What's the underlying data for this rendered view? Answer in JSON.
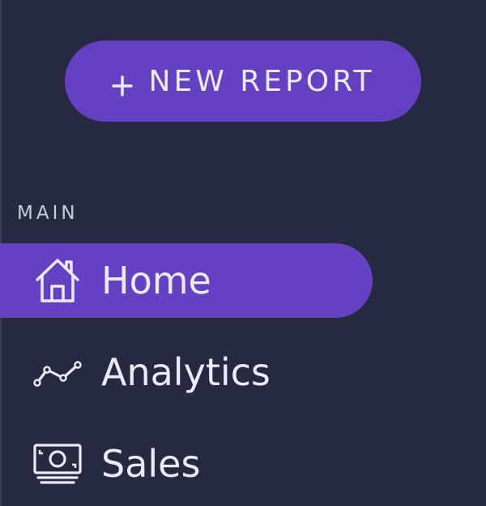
{
  "new_report_button": {
    "label": "NEW REPORT",
    "icon": "plus-icon"
  },
  "section": {
    "label": "MAIN"
  },
  "nav": [
    {
      "label": "Home",
      "icon": "home-icon",
      "active": true
    },
    {
      "label": "Analytics",
      "icon": "line-chart-icon",
      "active": false
    },
    {
      "label": "Sales",
      "icon": "money-icon",
      "active": false
    }
  ],
  "colors": {
    "background": "#252a40",
    "accent": "#6441c2",
    "text": "#ece9f8"
  }
}
